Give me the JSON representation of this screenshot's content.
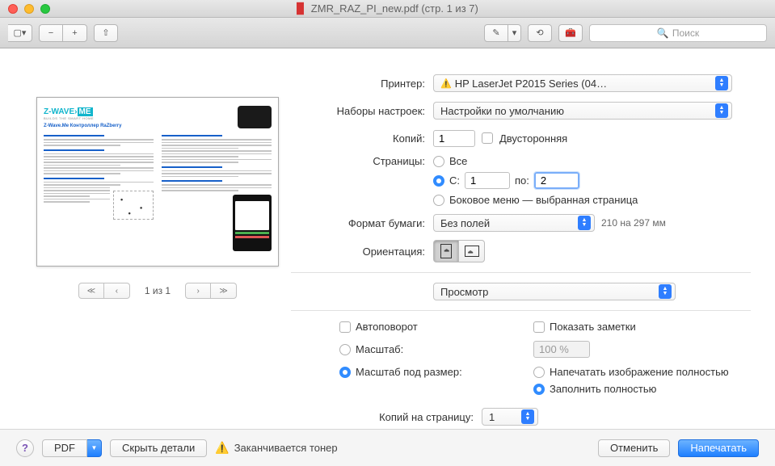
{
  "window": {
    "title": "ZMR_RAZ_PI_new.pdf (стр. 1 из 7)"
  },
  "toolbar": {
    "search_placeholder": "Поиск"
  },
  "preview": {
    "logo_a": "Z-WAVE",
    "logo_b": "ME",
    "logo_sub": "BUILDS THE SMART HOME",
    "doc_title": "Z-Wave.Me Контроллер RaZberry",
    "pager": "1 из 1"
  },
  "settings": {
    "printer_label": "Принтер:",
    "printer_value": "HP LaserJet P2015 Series (04…",
    "presets_label": "Наборы настроек:",
    "presets_value": "Настройки по умолчанию",
    "copies_label": "Копий:",
    "copies_value": "1",
    "duplex_label": "Двусторонняя",
    "pages_label": "Страницы:",
    "pages_all": "Все",
    "pages_from": "С:",
    "pages_from_value": "1",
    "pages_to": "по:",
    "pages_to_value": "2",
    "pages_side": "Боковое меню — выбранная страница",
    "paper_label": "Формат бумаги:",
    "paper_value": "Без полей",
    "paper_dim": "210 на 297 мм",
    "orientation_label": "Ориентация:",
    "view_select": "Просмотр",
    "autorotate": "Автоповорот",
    "show_notes": "Показать заметки",
    "scale_label": "Масштаб:",
    "scale_value": "100 %",
    "scale_fit_label": "Масштаб под размер:",
    "print_full": "Напечатать изображение полностью",
    "fill_full": "Заполнить полностью",
    "copies_per_page_label": "Копий на страницу:",
    "copies_per_page_value": "1"
  },
  "footer": {
    "help": "?",
    "pdf": "PDF",
    "hide_details": "Скрыть детали",
    "toner": "Заканчивается тонер",
    "cancel": "Отменить",
    "print": "Напечатать"
  }
}
